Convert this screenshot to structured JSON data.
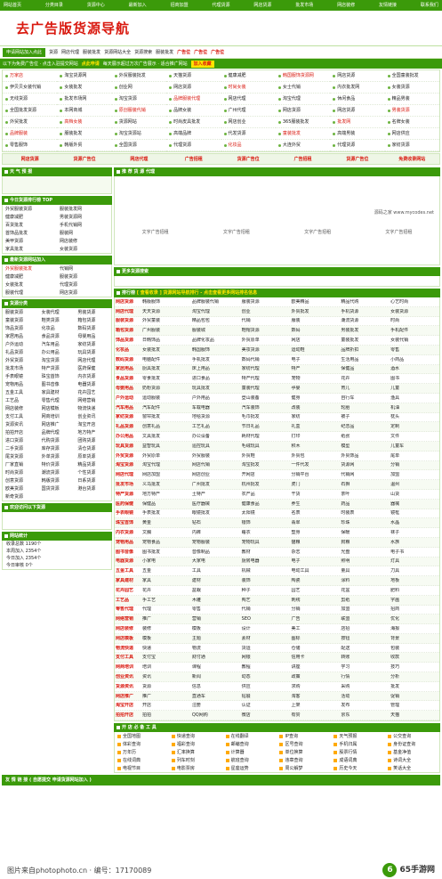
{
  "topnav": [
    "网站首页",
    "分类目录",
    "货源中心",
    "最新加入",
    "招商加盟",
    "代理货源",
    "网店货源",
    "批发市场",
    "网店装修",
    "友情链接",
    "联系我们"
  ],
  "logo": "去广告版货源导航",
  "addbtn": "申请网站加入点此",
  "adbar": [
    "货源",
    "网店代理",
    "服装批发",
    "货源网站大全",
    "货源搜索",
    "服装批发",
    "广告位",
    "广告位",
    "广告位"
  ],
  "notice": {
    "left": "以下为免费广告位 · 点击入驻提交网站",
    "mid": "点此申请",
    "right": "每天展示超过万次广告展示 · 适合推广网站",
    "btn": "加入收藏"
  },
  "sites": [
    [
      "万家店",
      "淘宝货源网",
      "外贸服装批发",
      "天猫货源",
      "健康减肥",
      "韩国服饰货源网",
      "网店货源",
      "全国童装批发"
    ],
    [
      "伊贝贝女装代销",
      "女装批发",
      "创业网",
      "网店货源",
      "时尚女装",
      "女士代销",
      "内衣批发网",
      "女装货源"
    ],
    [
      "无线货源",
      "批发市场网",
      "淘宝货源",
      "品牌服装代理",
      "网店代理",
      "淘宝代理",
      "休闲食品",
      "精品男装"
    ],
    [
      "全国批发货源",
      "本网商城",
      "原创服装代销",
      "品牌女装",
      "广州代理",
      "网店货源",
      "网店货源",
      "男装货源"
    ],
    [
      "外贸批发",
      "高档女装",
      "货源网站",
      "时尚皮具批发",
      "网店创业",
      "365服装批发",
      "批发网",
      "名牌女装"
    ],
    [
      "品牌服装",
      "服装批发",
      "淘宝货源站",
      "高端品牌",
      "代发货源",
      "童装批发",
      "高端男装",
      "网店供应"
    ],
    [
      "零售服饰",
      "韩版外贸",
      "全国货源",
      "代理货源",
      "化妆品",
      "大连外贸",
      "代理货源",
      "家纺货源"
    ]
  ],
  "tabs": [
    "网店货源",
    "货源广告位",
    "网店代理",
    "广告招租",
    "货源广告位",
    "广告招租",
    "货源广告位",
    "免费收录网站"
  ],
  "left": {
    "weather_title": "天 气 预 报",
    "rank_title": "今日货源排行榜 TOP",
    "rank": [
      "外贸服装货源",
      "服装批发网",
      "健康减肥",
      "男装货源网",
      "百货批发",
      "手机代销网",
      "首饰品批发",
      "服装网",
      "美甲货源",
      "网店装修",
      "家具批发",
      "女装货源"
    ],
    "new_title": "最新货源网站加入",
    "newsites": [
      "外贸服装批发",
      "代销网",
      "健康减肥",
      "服装货源",
      "女装批发",
      "代理货源",
      "服装代理",
      "网店货源"
    ],
    "cat_title": "货源分类",
    "cats": [
      "服装货源",
      "女装代理",
      "男装货源",
      "童装货源",
      "鞋类货源",
      "箱包货源",
      "饰品货源",
      "化妆品",
      "数码货源",
      "家居用品",
      "食品货源",
      "母婴用品",
      "户外运动",
      "汽车用品",
      "家纺货源",
      "礼品货源",
      "办公用品",
      "玩具货源",
      "外贸货源",
      "淘宝货源",
      "网店代理",
      "批发市场",
      "特产货源",
      "医药保健",
      "手表眼镜",
      "珠宝首饰",
      "内衣货源",
      "宠物用品",
      "图书音像",
      "电器货源",
      "五金工具",
      "家具建材",
      "花卉园艺",
      "工艺品",
      "零售代理",
      "网络营销",
      "网店装修",
      "网店模板",
      "物流快递",
      "支付工具",
      "网商培训",
      "创业资讯",
      "货源资讯",
      "网店推广",
      "淘宝开店",
      "拍拍开店",
      "品牌代理",
      "地方特产",
      "进口货源",
      "代购货源",
      "团购货源",
      "二手货源",
      "库存货源",
      "清仓货源",
      "尾货货源",
      "外单货源",
      "原单货源",
      "厂家直销",
      "特价货源",
      "精品货源",
      "时尚货源",
      "潮流货源",
      "个性货源",
      "创意货源",
      "韩版货源",
      "日系货源",
      "欧美货源",
      "国货货源",
      "港台货源",
      "新奇货源"
    ],
    "collect_title": "欢迎访问以下货源",
    "stat_title": "网站统计",
    "stats": [
      "收录总数 1190个",
      "本周加入 2354个",
      "今日加入 2354个",
      "今日审核 0个"
    ]
  },
  "right": {
    "ad_title": "推 荐 货 源 代理",
    "ad_src": "源码之家 www.mycodes.net",
    "ad_text": [
      "文字广告招租",
      "文字广告招租",
      "文字广告招租",
      "文字广告招租"
    ],
    "more_title": "更多货源搜索",
    "rank_title": "排行榜",
    "rank_note": "[ 查看收录 ] 货源网站导航排行 - 点击查看更多网站排名信息",
    "rows": [
      [
        "网店货源",
        "韩版服饰",
        "品牌服装代销",
        "服装货源",
        "欧美精品",
        "精品代购",
        "心艺时尚",
        "淘宝货源"
      ],
      [
        "网店代理",
        "天天货源",
        "淘宝代理",
        "创业",
        "外贸批发",
        "手机货源",
        "女装货源",
        "皮具货源"
      ],
      [
        "服装货源",
        "外贸童装",
        "精品包包",
        "代销",
        "服装",
        "潮流货源",
        "时尚",
        "外贸"
      ],
      [
        "箱包货源",
        "广州服装",
        "服装城",
        "鞋帽货源",
        "数码",
        "男装批发",
        "手机配件",
        "网店创业"
      ],
      [
        "饰品货源",
        "日韩饰品",
        "品牌化妆品",
        "外贸原单",
        "网店",
        "童装批发",
        "女装代销",
        "批发市场"
      ],
      [
        "化妆品",
        "女装批发",
        "韩国服饰",
        "美妆货源",
        "运动鞋",
        "品牌折扣",
        "零售",
        "家居"
      ],
      [
        "数码货源",
        "电脑配件",
        "手机批发",
        "数码代销",
        "电子",
        "生活用品",
        "小商品",
        "食品"
      ],
      [
        "家居用品",
        "厨具批发",
        "床上用品",
        "家纺代理",
        "特产",
        "保健品",
        "酒水",
        "茶叶"
      ],
      [
        "食品货源",
        "零食批发",
        "进口食品",
        "特产代理",
        "宠物",
        "花卉",
        "图书",
        "文具"
      ],
      [
        "母婴用品",
        "奶粉货源",
        "玩具批发",
        "童装代理",
        "孕婴",
        "育儿",
        "儿童",
        "早教"
      ],
      [
        "户外运动",
        "运动服装",
        "户外用品",
        "登山装备",
        "健身",
        "自行车",
        "渔具",
        "球类"
      ],
      [
        "汽车用品",
        "汽车配件",
        "车载电器",
        "汽车装饰",
        "改装",
        "轮胎",
        "机油",
        "导航"
      ],
      [
        "家纺货源",
        "窗帘批发",
        "地毯货源",
        "毛巾批发",
        "家纺",
        "被子",
        "枕头",
        "床单"
      ],
      [
        "礼品货源",
        "创意礼品",
        "工艺礼品",
        "节日礼品",
        "礼盒",
        "纪念品",
        "定制",
        "饰品"
      ],
      [
        "办公用品",
        "文具批发",
        "办公设备",
        "耗材代理",
        "打印",
        "纸张",
        "文件",
        "桌椅"
      ],
      [
        "玩具货源",
        "益智玩具",
        "遥控玩具",
        "毛绒玩具",
        "积木",
        "模型",
        "儿童车",
        "拼图"
      ],
      [
        "外贸货源",
        "外贸原单",
        "外贸服装",
        "外贸鞋",
        "外贸包",
        "外贸饰品",
        "尾单",
        "出口"
      ],
      [
        "淘宝货源",
        "淘宝代理",
        "网店代销",
        "淘宝批发",
        "一件代发",
        "货源网",
        "分销",
        "代理"
      ],
      [
        "网店代理",
        "网店加盟",
        "网店创业",
        "开网店",
        "分销平台",
        "代销网",
        "加盟",
        "货源"
      ],
      [
        "批发市场",
        "义乌批发",
        "广州批发",
        "杭州批发",
        "虎门",
        "石狮",
        "温州",
        "深圳"
      ],
      [
        "特产货源",
        "地方特产",
        "土特产",
        "农产品",
        "干货",
        "茶叶",
        "山货",
        "海鲜"
      ],
      [
        "医药保健",
        "保健品",
        "医疗器械",
        "健康食品",
        "养生",
        "药品",
        "器械",
        "营养"
      ],
      [
        "手表眼镜",
        "手表批发",
        "眼镜批发",
        "太阳镜",
        "名表",
        "时装表",
        "镜框",
        "配件"
      ],
      [
        "珠宝首饰",
        "黄金",
        "钻石",
        "银饰",
        "翡翠",
        "珍珠",
        "水晶",
        "玉石"
      ],
      [
        "内衣货源",
        "文胸",
        "内裤",
        "睡衣",
        "塑身",
        "保暖",
        "袜子",
        "家居服"
      ],
      [
        "宠物用品",
        "宠物食品",
        "宠物服装",
        "宠物玩具",
        "猫粮",
        "狗粮",
        "水族",
        "鸟类"
      ],
      [
        "图书音像",
        "图书批发",
        "音像制品",
        "教材",
        "杂志",
        "光盘",
        "电子书",
        "文学"
      ],
      [
        "电器货源",
        "小家电",
        "大家电",
        "厨房电器",
        "电子",
        "照明",
        "灯具",
        "开关"
      ],
      [
        "五金工具",
        "五金",
        "工具",
        "机械",
        "电动工具",
        "量具",
        "刀具",
        "紧固件"
      ],
      [
        "家具建材",
        "家具",
        "建材",
        "装饰",
        "陶瓷",
        "涂料",
        "地板",
        "卫浴"
      ],
      [
        "花卉园艺",
        "花卉",
        "盆栽",
        "种子",
        "园艺",
        "花盆",
        "肥料",
        "绿植"
      ],
      [
        "工艺品",
        "手工艺",
        "木雕",
        "陶艺",
        "刺绣",
        "剪纸",
        "字画",
        "雕塑"
      ],
      [
        "零售代理",
        "代理",
        "零售",
        "代销",
        "分销",
        "加盟",
        "招商",
        "合作"
      ],
      [
        "网络营销",
        "推广",
        "营销",
        "SEO",
        "广告",
        "联盟",
        "优化",
        "策划"
      ],
      [
        "网店装修",
        "装修",
        "模板",
        "设计",
        "美工",
        "店招",
        "海报",
        "详情页"
      ],
      [
        "网店模板",
        "模板",
        "主题",
        "素材",
        "图标",
        "按钮",
        "背景",
        "边框"
      ],
      [
        "物流快递",
        "快递",
        "物流",
        "货运",
        "仓储",
        "配送",
        "包装",
        "邮政"
      ],
      [
        "支付工具",
        "支付宝",
        "财付通",
        "网银",
        "信用卡",
        "转账",
        "收款",
        "结算"
      ],
      [
        "网商培训",
        "培训",
        "课程",
        "教程",
        "讲座",
        "学习",
        "技巧",
        "经验"
      ],
      [
        "创业资讯",
        "资讯",
        "新闻",
        "动态",
        "政策",
        "行情",
        "分析",
        "报告"
      ],
      [
        "货源资讯",
        "货源",
        "信息",
        "供应",
        "求购",
        "采购",
        "批发",
        "价格"
      ],
      [
        "网店推广",
        "推广",
        "直通车",
        "钻展",
        "淘客",
        "活动",
        "促销",
        "引流"
      ],
      [
        "淘宝开店",
        "开店",
        "注册",
        "认证",
        "上架",
        "发布",
        "管理",
        "运营"
      ],
      [
        "拍拍开店",
        "拍拍",
        "QQ网购",
        "微店",
        "有赞",
        "京东",
        "天猫",
        "拼多多"
      ]
    ],
    "tools_title": "开 店 必 备 工 具",
    "tools": [
      "全国地图",
      "快递查询",
      "在线翻译",
      "IP查询",
      "天气预报",
      "公交查询",
      "体彩查询",
      "福彩查询",
      "邮编查询",
      "区号查询",
      "手机归属",
      "身份证查询",
      "万年历",
      "汇率换算",
      "计算器",
      "单位换算",
      "股票行情",
      "基金净值",
      "在线词典",
      "列车时刻",
      "航班查询",
      "违章查询",
      "成语词典",
      "诗词大全",
      "电视节目",
      "电影票房",
      "星座运势",
      "周公解梦",
      "历史今天",
      "笑话大全"
    ],
    "friend_title": "友 情 链 接 ( 自愿提交 申请货源网站加入 )"
  },
  "watermark": "图片来自photophoto.cn · 编号：17170089",
  "brand": {
    "mark": "6",
    "text": "65手游网"
  }
}
